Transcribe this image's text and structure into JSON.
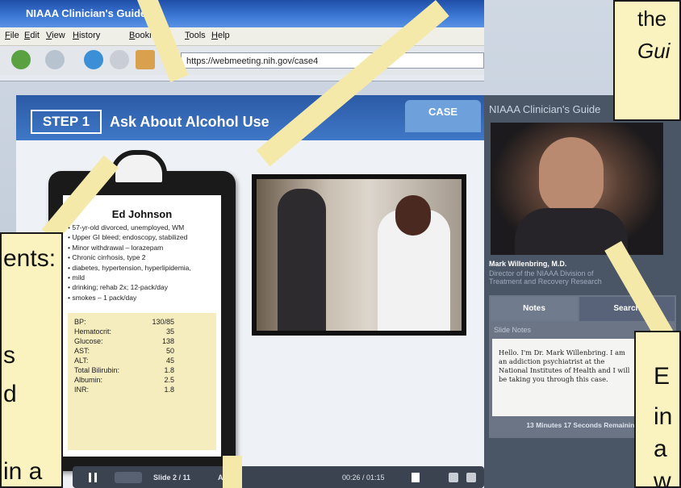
{
  "browser": {
    "title": "NIAAA Clinician's Guide:",
    "menu": [
      "File",
      "Edit",
      "View",
      "History",
      "Bookmarks",
      "Tools",
      "Help"
    ],
    "url": "https://webmeeting.nih.gov/case4"
  },
  "module": {
    "step_badge": "STEP 1",
    "step_title": "Ask About Alcohol Use",
    "case_tab": "CASE"
  },
  "patient": {
    "name": "Ed Johnson",
    "history": [
      "57-yr-old divorced, unemployed, WM",
      "Upper GI bleed; endoscopy, stabilized",
      "Minor withdrawal – lorazepam",
      "Chronic cirrhosis, type 2",
      "diabetes, hypertension, hyperlipidemia,",
      "mild",
      "drinking; rehab 2x; 12-pack/day",
      "smokes – 1 pack/day"
    ],
    "labs": [
      {
        "label": "BP:",
        "value": "130/85"
      },
      {
        "label": "Hematocrit:",
        "value": "35"
      },
      {
        "label": "Glucose:",
        "value": "138"
      },
      {
        "label": "AST:",
        "value": "50"
      },
      {
        "label": "ALT:",
        "value": "45"
      },
      {
        "label": "Total Bilirubin:",
        "value": "1.8"
      },
      {
        "label": "Albumin:",
        "value": "2.5"
      },
      {
        "label": "INR:",
        "value": "1.8"
      }
    ]
  },
  "player": {
    "slide": "Slide 2 / 11",
    "audio": "Audio",
    "time": "00:26 / 01:15"
  },
  "sidebar": {
    "header": "NIAAA Clinician's Guide",
    "speaker_name": "Mark Willenbring, M.D.",
    "speaker_role_1": "Director of the NIAAA Division of",
    "speaker_role_2": "Treatment and Recovery Research",
    "tab_notes": "Notes",
    "tab_search": "Search",
    "slide_notes_label": "Slide Notes",
    "notes_text": "Hello.  I'm Dr. Mark Willenbring.  I am an addiction psychiatrist at the National Institutes of Health and I will be taking you through this case.",
    "time_remaining": "13 Minutes 17 Seconds Remaining"
  },
  "callouts": {
    "top_right_1": "the",
    "top_right_2": "Gui",
    "left_1": "ents:",
    "left_2": "s",
    "left_3": "d",
    "left_4": "in a",
    "br_1": "E",
    "br_2": "in",
    "br_3": "a",
    "br_4": "w"
  }
}
